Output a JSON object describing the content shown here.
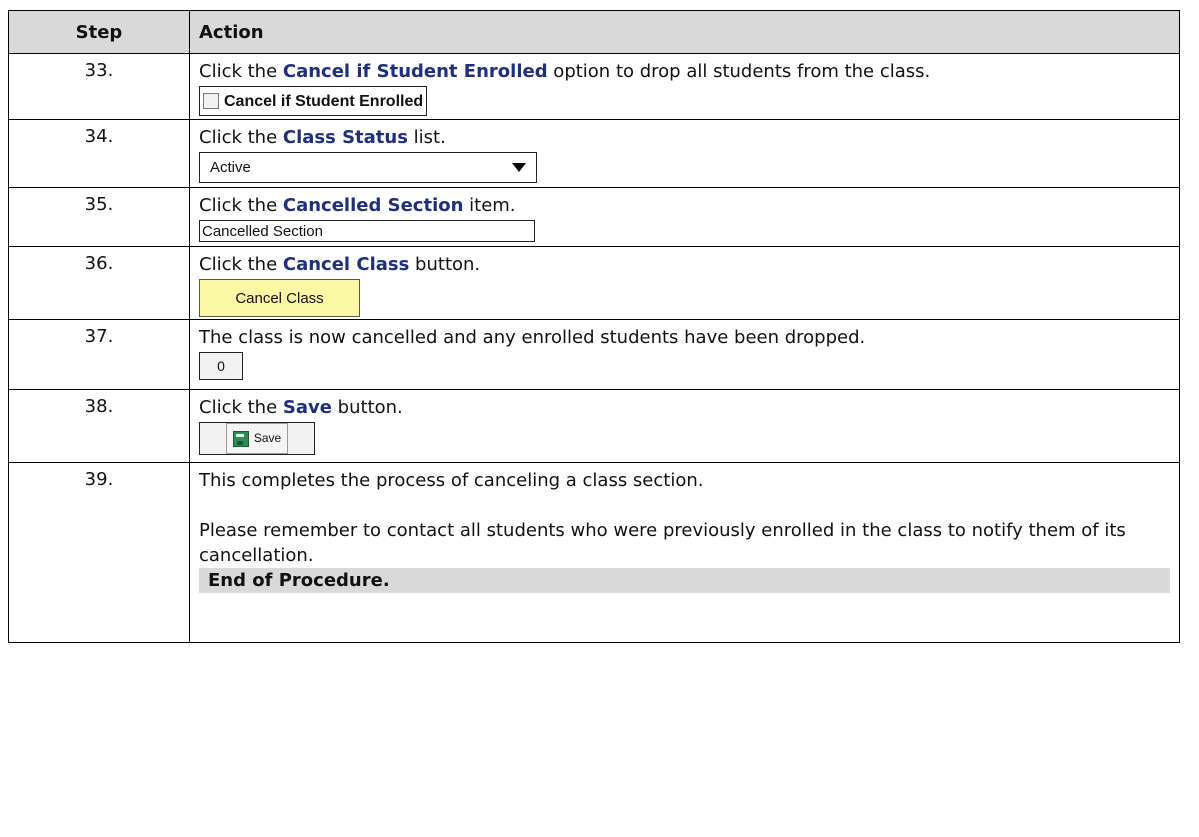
{
  "header": {
    "step": "Step",
    "action": "Action"
  },
  "rows": [
    {
      "step": "33.",
      "pre": "Click the ",
      "hl": "Cancel if Student Enrolled",
      "post": " option to drop all students from the class.",
      "widget_label": "Cancel if Student Enrolled"
    },
    {
      "step": "34.",
      "pre": "Click the ",
      "hl": "Class Status",
      "post": " list.",
      "widget_value": "Active"
    },
    {
      "step": "35.",
      "pre": "Click the ",
      "hl": "Cancelled Section",
      "post": " item.",
      "widget_value": "Cancelled Section"
    },
    {
      "step": "36.",
      "pre": "Click the ",
      "hl": "Cancel Class",
      "post": " button.",
      "widget_label": "Cancel Class"
    },
    {
      "step": "37.",
      "text": "The class is now cancelled and any enrolled students have been dropped.",
      "widget_value": "0"
    },
    {
      "step": "38.",
      "pre": "Click the ",
      "hl": "Save",
      "post": " button.",
      "widget_label": "Save"
    },
    {
      "step": "39.",
      "text": "This completes the process of canceling a class section.",
      "text2": "Please remember to contact all students who were previously enrolled in the class to notify them of its cancellation.",
      "end": "End of Procedure."
    }
  ],
  "colors": {
    "highlight": "#1f2f7a",
    "header_bg": "#d9d9d9",
    "button_yellow": "#fbf8a4"
  }
}
